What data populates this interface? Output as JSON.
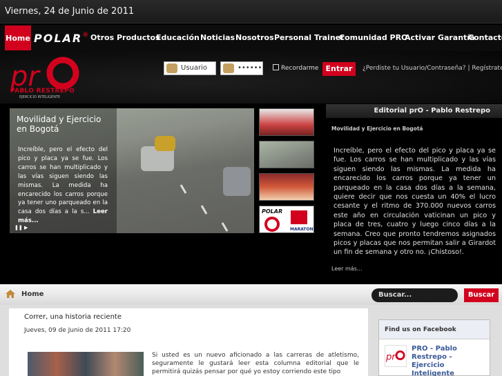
{
  "date_bar": {
    "text": "Viernes, 24 de Junio de 2011"
  },
  "nav": {
    "home": "Home",
    "polar": "POLAR",
    "items": [
      "Otros Productos",
      "Educación",
      "Noticias",
      "Nosotros",
      "Personal Trainer",
      "Comunidad PRO",
      "Activar Garantía",
      "Contacto"
    ]
  },
  "brand": {
    "name": "PABLO RESTREPO",
    "sub": "EJERCICIO INTELIGENTE"
  },
  "login": {
    "user_placeholder": "Usuario",
    "password_value": "••••••",
    "remember": "Recordarme",
    "enter": "Entrar",
    "forgot": "¿Perdiste tu Usuario/Contraseña?",
    "separator": "|",
    "register": "Regístrate"
  },
  "featured": {
    "title": "Movilidad y Ejercicio en Bogotá",
    "text": "Increíble, pero el efecto del pico y placa ya se fue. Los carros se han multiplicado y las vías siguen siendo las mismas. La medida ha encarecido los carros porque ya tener uno parqueado en la casa dos días a la s...",
    "more": "Leer más..."
  },
  "editorial": {
    "heading": "Editorial prO - Pablo Restrepo",
    "subtitle": "Movilidad y Ejercicio en Bogotá",
    "text": "Increíble, pero el efecto del pico y placa ya se fue. Los carros se han multiplicado y las vías siguen siendo las mismas. La medida ha encarecido los carros porque ya tener un parqueado en la casa dos días a la semana, quiere decir que nos cuesta un 40% el lucro cesante y el ritmo de 370.000 nuevos carros este año en circulación vaticinan un pico y placa de tres, cuatro y luego cinco días a la semana. Creo que pronto tendremos asignados picos y placas que nos permitan salir a Girardot un fin de semana y otro no. ¡Chistoso!.",
    "more": "Leer más..."
  },
  "breadcrumb": {
    "label": "Home"
  },
  "search": {
    "placeholder": "Buscar...",
    "button": "Buscar"
  },
  "article": {
    "title": "Correr, una historia reciente",
    "date": "Jueves, 09 de Junio de 2011 17:20",
    "text": "Si usted es un nuevo aficionado a las carreras de atletismo, seguramente le gustará leer esta columna editorial que le permitirá quizás pensar por qué yo estoy corriendo este tipo"
  },
  "facebook": {
    "heading": "Find us on Facebook",
    "page_name": "PRO - Pablo Restrepo - Ejercicio Inteligente"
  },
  "colors": {
    "accent": "#d2021e",
    "facebook": "#3b5998"
  }
}
